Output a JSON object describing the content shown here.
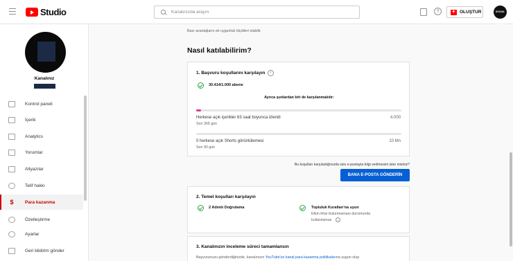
{
  "header": {
    "app_name": "Studio",
    "search_placeholder": "Kanalınızda arayın",
    "help_label": "?",
    "create_label": "OLUŞTUR",
    "avatar_text": "SOCIAL BLADE"
  },
  "sidebar": {
    "channel_label": "Kanalınız",
    "items": [
      {
        "label": "Kontrol paneli",
        "icon": "dashboard-icon"
      },
      {
        "label": "İçerik",
        "icon": "content-icon"
      },
      {
        "label": "Analytics",
        "icon": "analytics-icon"
      },
      {
        "label": "Yorumlar",
        "icon": "comments-icon"
      },
      {
        "label": "Altyazılar",
        "icon": "subtitles-icon"
      },
      {
        "label": "Telif hakkı",
        "icon": "copyright-icon"
      },
      {
        "label": "Para kazanma",
        "icon": "dollar-icon",
        "active": true
      },
      {
        "label": "Özelleştirme",
        "icon": "customization-icon"
      },
      {
        "label": "Ayarlar",
        "icon": "settings-icon"
      },
      {
        "label": "Geri bildirim gönder",
        "icon": "feedback-icon"
      }
    ]
  },
  "main": {
    "intro": "Bazı avantajların ek uygunluk ölçütleri olabilir.",
    "title": "Nasıl katılabilirim?",
    "card1": {
      "title": "1. Başvuru koşullarını karşılayın",
      "info": "i",
      "subscribers": "30.414/1.000 abone",
      "also_label": "Ayrıca şunlardan biri de karşılanmalıdır:",
      "metrics": [
        {
          "label": "Herkese açık içerikler 63 saat boyunca izlendi",
          "sub": "Son 365 gün",
          "target": "4.000",
          "progress": 0.016
        },
        {
          "label": "0 herkese açık Shorts görüntülemesi",
          "sub": "Son 90 gün",
          "target": "10 Mn",
          "progress": 0
        }
      ]
    },
    "email_prompt": "Bu koşulları karşıladığınızda size e-postayla bilgi verilmesini ister misiniz?",
    "email_button": "BANA E-POSTA GÖNDERİN",
    "card2": {
      "title": "2. Temel koşulları karşılayın",
      "left_item": "2 Adımlı Doğrulama",
      "right_item": "Topluluk Kuralları'na uyun",
      "right_sub1": "Etkin ihtar bulunmaması durumunda",
      "right_sub2": "kullanılamaz",
      "info": "i"
    },
    "card3": {
      "title": "3. Kanalınızın inceleme süreci tamamlansın",
      "text_before": "Başvurunuzu gönderdiğinizde, kanalınızın ",
      "link": "YouTube'un kanal para kazanma politikaları",
      "text_after": "na uygun olup"
    }
  },
  "colors": {
    "accent_red": "#cc0000",
    "button_blue": "#065fd4",
    "check_green": "#2ba640",
    "progress_pink": "#e5388e"
  }
}
